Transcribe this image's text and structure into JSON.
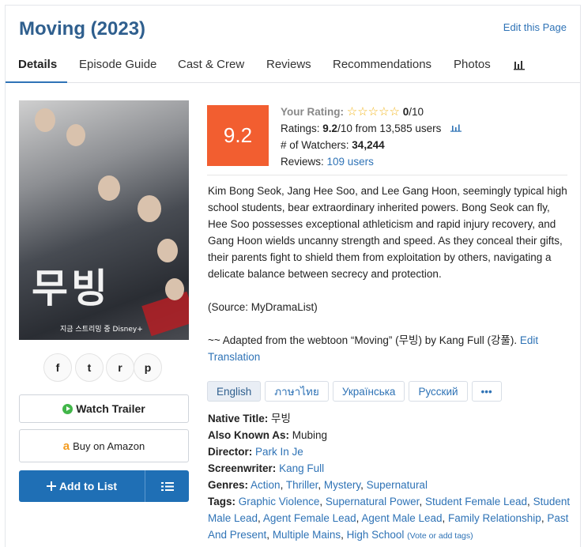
{
  "header": {
    "title": "Moving (2023)",
    "edit_link": "Edit this Page"
  },
  "tabs": [
    {
      "label": "Details",
      "active": true
    },
    {
      "label": "Episode Guide"
    },
    {
      "label": "Cast & Crew"
    },
    {
      "label": "Reviews"
    },
    {
      "label": "Recommendations"
    },
    {
      "label": "Photos"
    }
  ],
  "poster": {
    "title_text": "무빙",
    "bottom_text": "지금 스트리밍 중  Disney+"
  },
  "social": [
    "f",
    "t",
    "r",
    "p"
  ],
  "buttons": {
    "watch_trailer": "Watch Trailer",
    "buy_amazon": "Buy on Amazon",
    "add_to_list": "Add to List"
  },
  "rating": {
    "score": "9.2",
    "your_rating_label": "Your Rating:",
    "your_rating_value": "0",
    "your_rating_max": "/10",
    "ratings_label": "Ratings:",
    "ratings_value": "9.2",
    "ratings_suffix": "/10 from 13,585 users",
    "watchers_label": "# of Watchers:",
    "watchers_value": "34,244",
    "reviews_label": "Reviews:",
    "reviews_value": "109 users"
  },
  "synopsis": {
    "p1": "Kim Bong Seok, Jang Hee Soo, and Lee Gang Hoon, seemingly typical high school students, bear extraordinary inherited powers. Bong Seok can fly, Hee Soo possesses exceptional athleticism and rapid injury recovery, and Gang Hoon wields uncanny strength and speed. As they conceal their gifts, their parents fight to shield them from exploitation by others, navigating a delicate balance between secrecy and protection.",
    "p2": "(Source: MyDramaList)",
    "p3": "~~ Adapted from the webtoon “Moving” (무빙) by Kang Full (강풀).",
    "edit_translation": "Edit Translation"
  },
  "languages": [
    "English",
    "ภาษาไทย",
    "Українська",
    "Русский",
    "•••"
  ],
  "details": {
    "native_title_label": "Native Title:",
    "native_title": "무빙",
    "aka_label": "Also Known As:",
    "aka": "Mubing",
    "director_label": "Director:",
    "director": "Park In Je",
    "screenwriter_label": "Screenwriter:",
    "screenwriter": "Kang Full",
    "genres_label": "Genres:",
    "genres": [
      "Action",
      "Thriller",
      "Mystery",
      "Supernatural"
    ],
    "tags_label": "Tags:",
    "tags": [
      "Graphic Violence",
      "Supernatural Power",
      "Student Female Lead",
      "Student Male Lead",
      "Agent Female Lead",
      "Agent Male Lead",
      "Family Relationship",
      "Past And Present",
      "Multiple Mains",
      "High School"
    ],
    "vote_tags": "(Vote or add tags)"
  },
  "colors": {
    "title": "#2f5f8e",
    "link": "#2f73b6",
    "score_bg": "#f25e30",
    "add_button": "#1f6fb5"
  }
}
